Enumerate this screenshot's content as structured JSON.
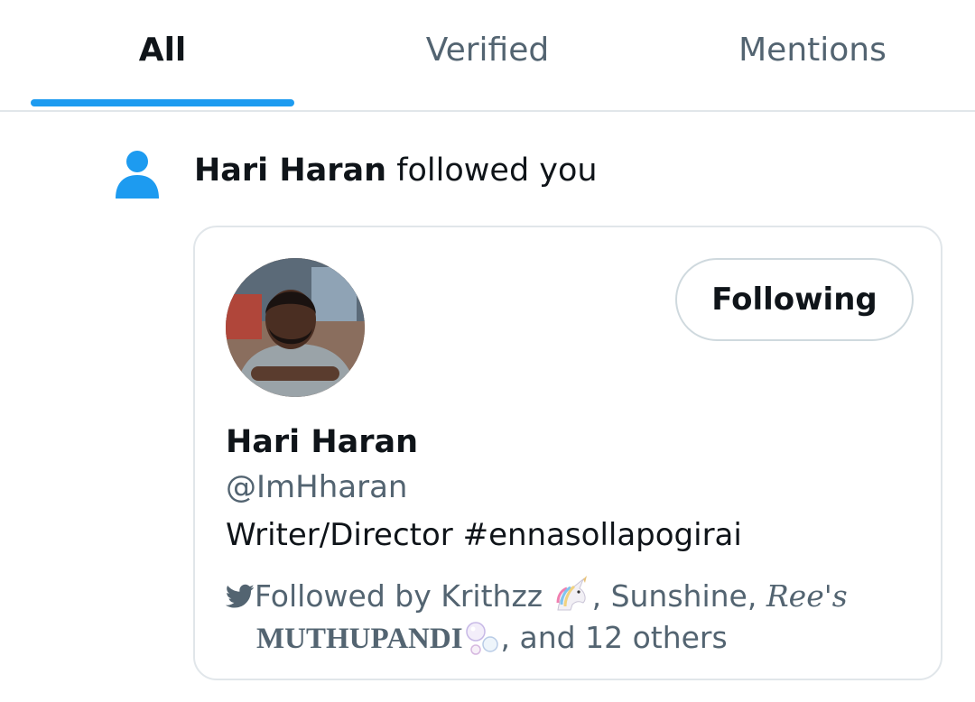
{
  "tabs": [
    {
      "label": "All",
      "active": true
    },
    {
      "label": "Verified",
      "active": false
    },
    {
      "label": "Mentions",
      "active": false
    }
  ],
  "accent_color": "#1d9bf0",
  "notification": {
    "icon": "person-icon",
    "actor_name": "Hari Haran",
    "action_text": " followed you"
  },
  "card": {
    "display_name": "Hari Haran",
    "handle": "@ImHharan",
    "bio": "Writer/Director #ennasollapogirai",
    "follow_button_label": "Following",
    "followed_by": {
      "icon": "bird-icon",
      "prefix": "Followed by Krithzz ",
      "sep1": ", Sunshine, ",
      "fancy_name_1": "Ree's",
      "fancy_name_2": "MUTHUPANDI",
      "suffix": ", and 12 others"
    }
  }
}
